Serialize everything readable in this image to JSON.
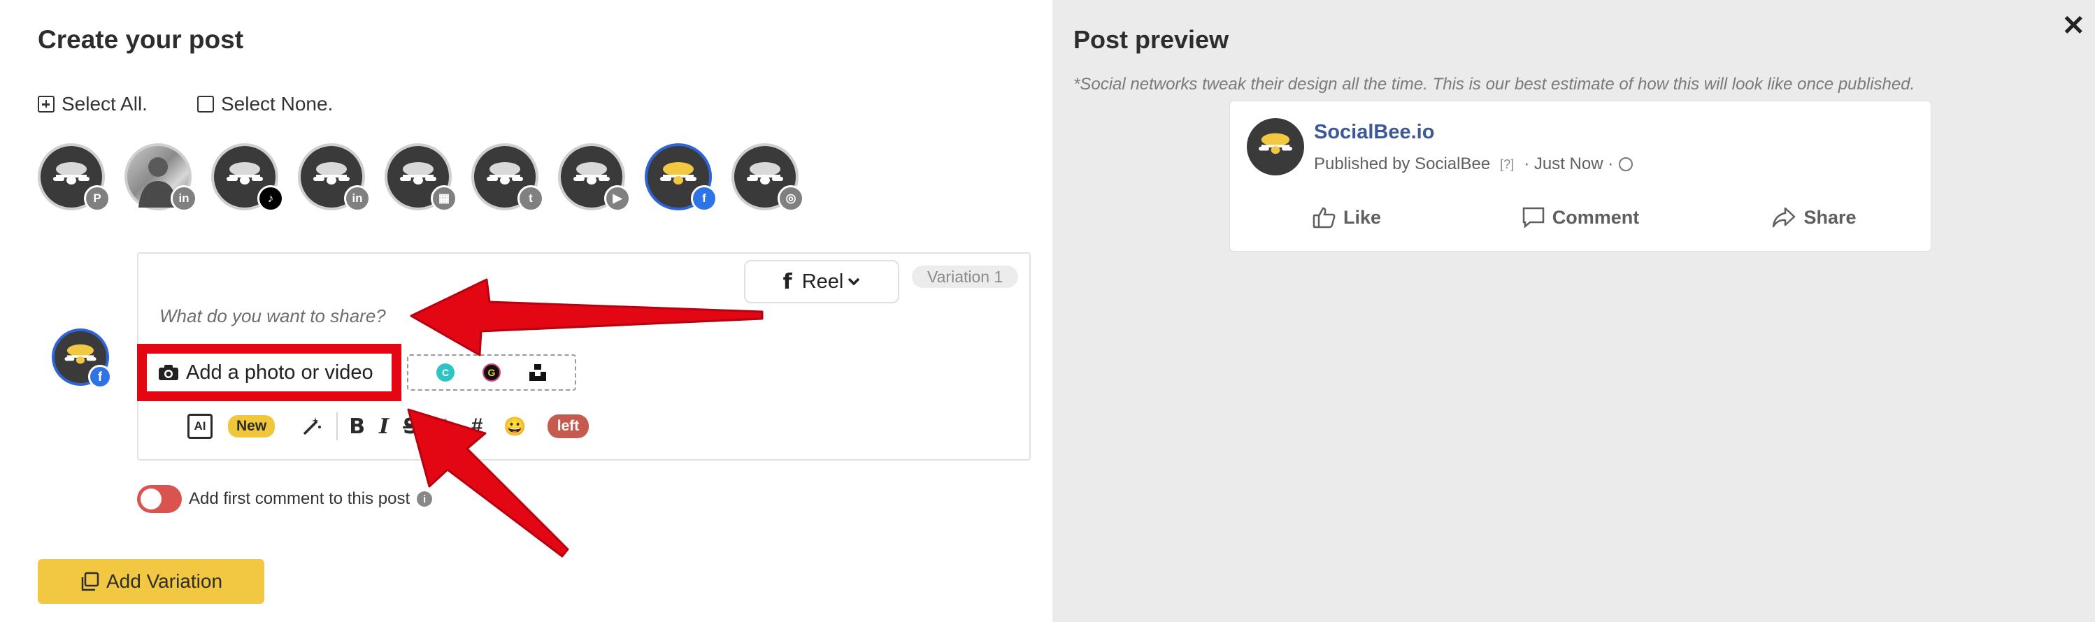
{
  "editor_panel": {
    "title": "Create your post",
    "select_all": "Select All.",
    "select_none": "Select None.",
    "accounts": [
      {
        "network": "pinterest",
        "badge": "P",
        "active": false
      },
      {
        "network": "linkedin",
        "badge": "in",
        "active": false
      },
      {
        "network": "tiktok",
        "badge": "♪",
        "active": false
      },
      {
        "network": "linkedin",
        "badge": "in",
        "active": false
      },
      {
        "network": "google-business",
        "badge": "▦",
        "active": false
      },
      {
        "network": "twitter",
        "badge": "t",
        "active": false
      },
      {
        "network": "youtube",
        "badge": "▶",
        "active": false
      },
      {
        "network": "facebook",
        "badge": "f",
        "active": true
      },
      {
        "network": "instagram",
        "badge": "◎",
        "active": false
      }
    ],
    "post_type": {
      "icon": "f",
      "label": "Reel"
    },
    "variation_label": "Variation 1",
    "placeholder": "What do you want to share?",
    "add_media_label": "Add a photo or video",
    "media_sources": [
      {
        "name": "canva",
        "glyph": "C",
        "color": "#2ec4c4"
      },
      {
        "name": "giphy",
        "glyph": "G",
        "color": "#111111"
      },
      {
        "name": "unsplash",
        "glyph": "▟",
        "color": "#111111"
      }
    ],
    "toolbar": {
      "ai_label": "AI",
      "new_badge": "New",
      "magic_icon": "⁄",
      "bold": "B",
      "italic": "I",
      "strike": "S",
      "hash": "#",
      "emoji": "😀",
      "chars_left": "left"
    },
    "first_comment_label": "Add first comment to this post",
    "add_variation_label": "Add Variation"
  },
  "preview_panel": {
    "title": "Post preview",
    "note": "*Social networks tweak their design all the time. This is our best estimate of how this will look like once published.",
    "page_name": "SocialBee.io",
    "published_by": "Published by SocialBee",
    "help_mark": "[?]",
    "time": "· Just Now ·",
    "actions": {
      "like": "Like",
      "comment": "Comment",
      "share": "Share"
    }
  },
  "colors": {
    "accent_yellow": "#f2c842",
    "facebook_blue": "#2f74e6",
    "annotation_red": "#e30613",
    "toggle_red": "#d9534f",
    "preview_bg": "#ebebeb"
  }
}
